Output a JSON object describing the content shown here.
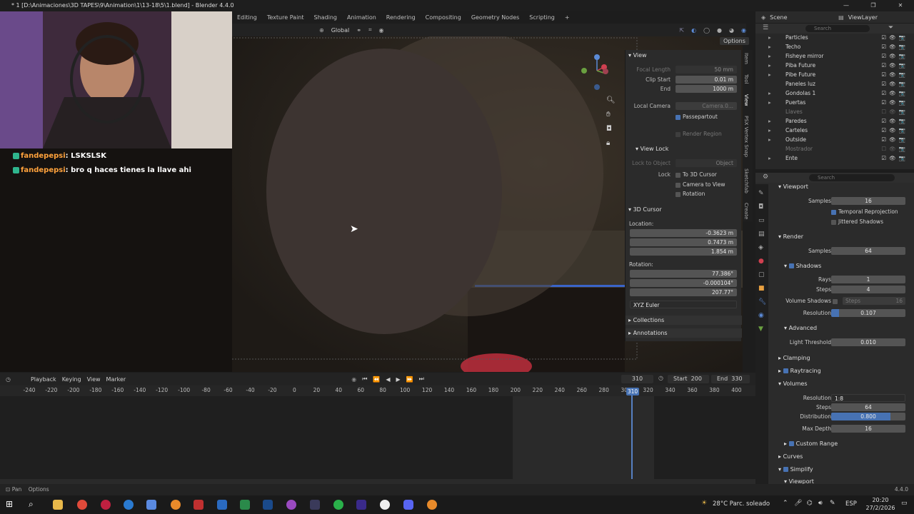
{
  "window": {
    "title": "* 1 [D:\\Animaciones\\3D TAPES\\9\\Animation\\1\\13-18\\5\\1.blend] - Blender 4.4.0",
    "controls": [
      "—",
      "❐",
      "✕"
    ]
  },
  "workspace_tabs": [
    "Editing",
    "Texture Paint",
    "Shading",
    "Animation",
    "Rendering",
    "Compositing",
    "Geometry Nodes",
    "Scripting",
    "+"
  ],
  "top_right": {
    "scene": "Scene",
    "view_layer": "ViewLayer"
  },
  "viewport_header": {
    "orientation": "Global",
    "options": "Options"
  },
  "overlay_stream": {
    "chat": [
      {
        "user": "fandepepsi",
        "message": "LSKSLSK"
      },
      {
        "user": "fandepepsi",
        "message": "bro q haces tienes la llave ahi"
      }
    ]
  },
  "npanel": {
    "view": {
      "header": "View",
      "focal_length_label": "Focal Length",
      "focal_length": "50 mm",
      "clip_start_label": "Clip Start",
      "clip_start": "0.01 m",
      "end_label": "End",
      "end": "1000 m",
      "local_camera_label": "Local Camera",
      "local_camera": "Camera.0...",
      "passepartout": "Passepartout",
      "render_region": "Render Region"
    },
    "view_lock": {
      "header": "View Lock",
      "lock_object_label": "Lock to Object",
      "lock_object": "Object",
      "lock_label": "Lock",
      "to_3d_cursor": "To 3D Cursor",
      "camera_to_view": "Camera to View",
      "rotation": "Rotation"
    },
    "cursor": {
      "header": "3D Cursor",
      "location_label": "Location:",
      "x": "-0.3623 m",
      "y": "0.7473 m",
      "z": "1.854 m",
      "rotation_label": "Rotation:",
      "rx": "77.386°",
      "ry": "-0.000104°",
      "rz": "207.77°",
      "mode": "XYZ Euler"
    },
    "collections": "Collections",
    "annotations": "Annotations",
    "side_tabs": [
      "Item",
      "Tool",
      "View",
      "PSX Vertex Snap",
      "Sketchfab",
      "Create"
    ]
  },
  "outliner": {
    "search_placeholder": "Search",
    "items": [
      {
        "name": "Particles",
        "dim": false
      },
      {
        "name": "Techo",
        "dim": false
      },
      {
        "name": "Fisheye mirror",
        "dim": false
      },
      {
        "name": "Piba Future",
        "dim": false
      },
      {
        "name": "Pibe Future",
        "dim": false
      },
      {
        "name": "Paneles luz",
        "dim": false
      },
      {
        "name": "Gondolas 1",
        "dim": false
      },
      {
        "name": "Puertas",
        "dim": false
      },
      {
        "name": "Llaves",
        "dim": true
      },
      {
        "name": "Paredes",
        "dim": false
      },
      {
        "name": "Carteles",
        "dim": false
      },
      {
        "name": "Outside",
        "dim": false
      },
      {
        "name": "Mostrador",
        "dim": true
      },
      {
        "name": "Ente",
        "dim": false
      }
    ]
  },
  "properties": {
    "search_placeholder": "Search",
    "viewport_header": "Viewport",
    "samples_label": "Samples",
    "viewport_samples": "16",
    "temporal_reprojection": "Temporal Reprojection",
    "jittered_shadows": "Jittered Shadows",
    "render_header": "Render",
    "render_samples": "64",
    "shadows_header": "Shadows",
    "rays_label": "Rays",
    "rays": "1",
    "steps_label": "Steps",
    "steps": "4",
    "volume_shadows_label": "Volume Shadows",
    "volume_steps_label": "Steps",
    "volume_steps": "16",
    "resolution_label": "Resolution",
    "resolution": "0.107",
    "advanced_header": "Advanced",
    "light_threshold_label": "Light Threshold",
    "light_threshold": "0.010",
    "clamping_header": "Clamping",
    "raytracing_header": "Raytracing",
    "volumes_header": "Volumes",
    "vol_resolution": "1:8",
    "vol_steps": "64",
    "distribution_label": "Distribution",
    "distribution": "0.800",
    "max_depth_label": "Max Depth",
    "max_depth": "16",
    "custom_range": "Custom Range",
    "curves_header": "Curves",
    "simplify_header": "Simplify",
    "simplify_viewport": "Viewport"
  },
  "timeline": {
    "menus": [
      "Playback",
      "Keying",
      "View",
      "Marker"
    ],
    "current_frame": "310",
    "start_label": "Start",
    "start": "200",
    "end_label": "End",
    "end": "330",
    "ticks": [
      "-240",
      "-220",
      "-200",
      "-180",
      "-160",
      "-140",
      "-120",
      "-100",
      "-80",
      "-60",
      "-40",
      "-20",
      "0",
      "20",
      "40",
      "60",
      "80",
      "100",
      "120",
      "140",
      "160",
      "180",
      "200",
      "220",
      "240",
      "260",
      "280",
      "300",
      "320",
      "340",
      "360",
      "380",
      "400"
    ]
  },
  "statusbar": {
    "left1": "Pan",
    "left2": "Options",
    "version": "4.4.0"
  },
  "taskbar": {
    "weather": "28°C  Parc. soleado",
    "lang": "ESP",
    "time": "20:20",
    "date": "27/2/2026"
  },
  "colors": {
    "accent": "#4772b3",
    "panel": "#2b2b2b",
    "bg": "#1d1d1d"
  }
}
